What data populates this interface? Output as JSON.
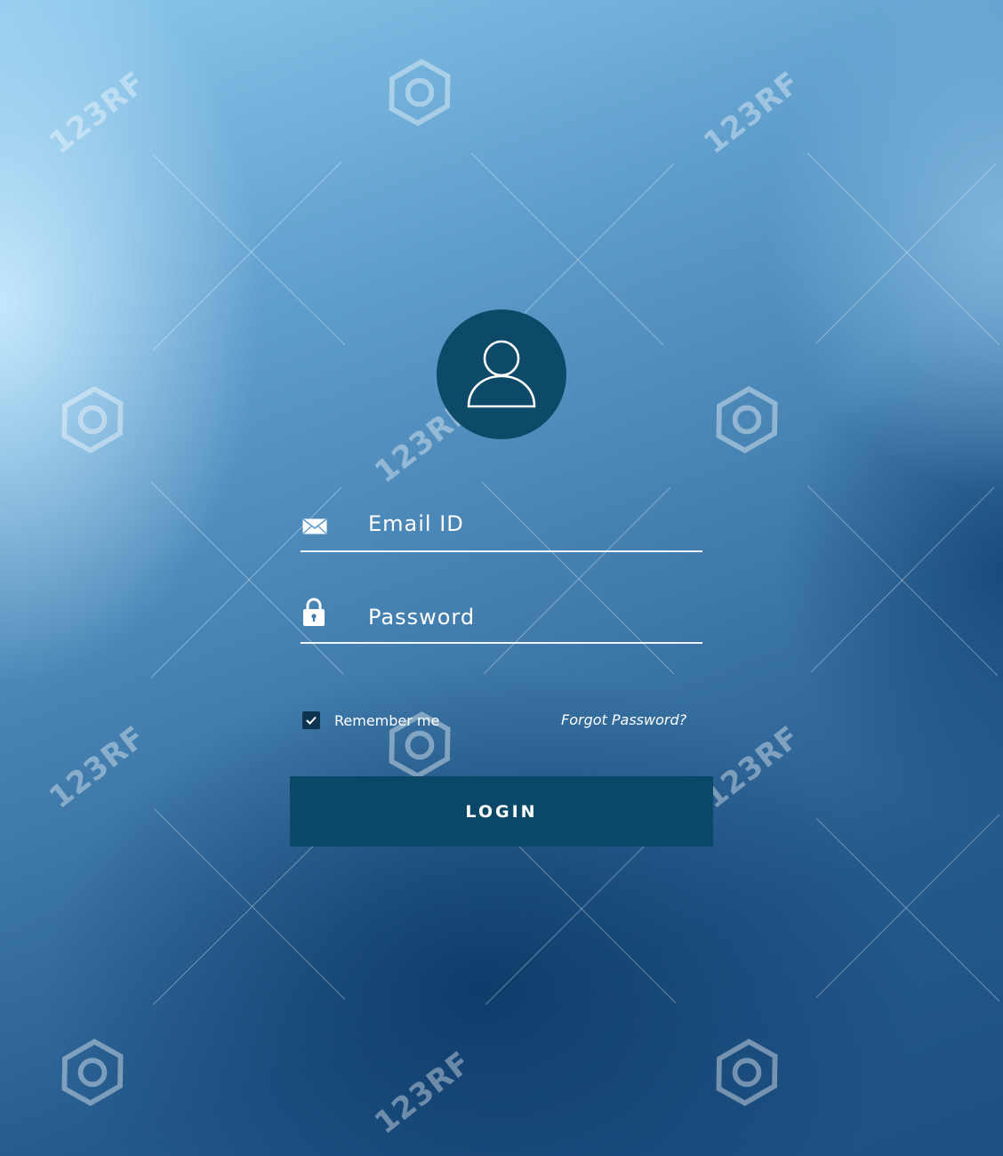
{
  "form": {
    "email_placeholder": "Email ID",
    "password_placeholder": "Password",
    "remember_label": "Remember me",
    "remember_checked": true,
    "forgot_label": "Forgot Password?",
    "login_label": "LOGIN"
  },
  "icons": {
    "avatar": "user-icon",
    "email": "envelope-icon",
    "password": "lock-icon",
    "checkbox": "check-icon"
  },
  "watermark": {
    "text": "123RF"
  },
  "colors": {
    "avatar_bg": "#0d4a68",
    "button_bg": "#0b4766",
    "checkbox_bg": "#0d3450",
    "text": "#ffffff"
  }
}
